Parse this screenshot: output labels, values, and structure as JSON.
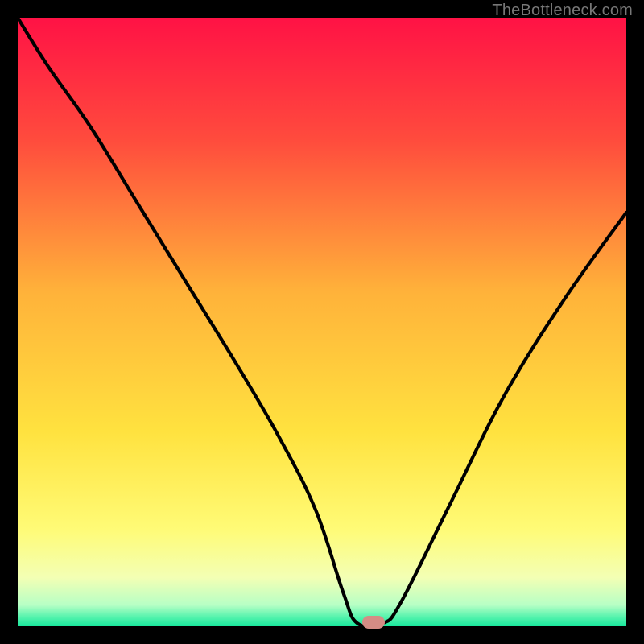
{
  "watermark": "TheBottleneck.com",
  "chart_data": {
    "type": "line",
    "title": "",
    "xlabel": "",
    "ylabel": "",
    "xlim": [
      0,
      100
    ],
    "ylim": [
      0,
      100
    ],
    "gradient_stops": [
      {
        "pct": 0,
        "color": "#ff1245"
      },
      {
        "pct": 20,
        "color": "#ff4b3d"
      },
      {
        "pct": 45,
        "color": "#ffb23a"
      },
      {
        "pct": 68,
        "color": "#ffe23f"
      },
      {
        "pct": 84,
        "color": "#fffb76"
      },
      {
        "pct": 92,
        "color": "#f3ffb4"
      },
      {
        "pct": 96.5,
        "color": "#b7ffc5"
      },
      {
        "pct": 98.5,
        "color": "#54f3ad"
      },
      {
        "pct": 100,
        "color": "#19e89d"
      }
    ],
    "series": [
      {
        "name": "bottleneck-curve",
        "x": [
          0,
          5,
          12,
          20,
          28,
          36,
          43,
          49,
          53.5,
          55.8,
          60,
          63,
          71,
          80,
          90,
          100
        ],
        "values": [
          100,
          92,
          82,
          69,
          56,
          43,
          31,
          19,
          5.5,
          0.5,
          0.5,
          4,
          20,
          38,
          54,
          68
        ]
      }
    ],
    "marker": {
      "x": 58.5,
      "y": 0.6
    }
  }
}
